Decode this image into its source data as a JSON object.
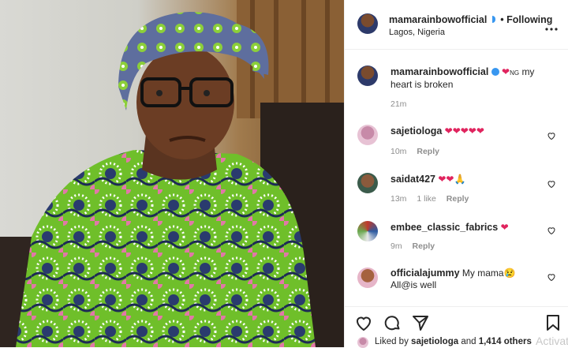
{
  "post": {
    "author": "mamarainbowofficial",
    "follow_status": "• Following",
    "location": "Lagos, Nigeria"
  },
  "caption": {
    "username": "mamarainbowofficial",
    "text_flag": "NG",
    "text": "my heart is broken",
    "time": "21m"
  },
  "comments": [
    {
      "username": "sajetiologa",
      "text": "❤❤❤❤❤",
      "time": "10m",
      "likes": "",
      "reply": "Reply"
    },
    {
      "username": "saidat427",
      "text": "❤❤🙏",
      "time": "13m",
      "likes": "1 like",
      "reply": "Reply"
    },
    {
      "username": "embee_classic_fabrics",
      "text": "❤",
      "time": "9m",
      "likes": "",
      "reply": "Reply"
    },
    {
      "username": "officialajummy",
      "text": "My mama😢",
      "text2": "All@is well",
      "time": "",
      "likes": "",
      "reply": ""
    }
  ],
  "footer": {
    "liked_prefix": "Liked by",
    "liked_user": "sajetiologa",
    "liked_and": "and",
    "liked_count": "1,414 others",
    "watermark": "Activat"
  },
  "colors": {
    "heart": "#ed4956",
    "verified": "#3897f0",
    "border": "#efefef"
  }
}
